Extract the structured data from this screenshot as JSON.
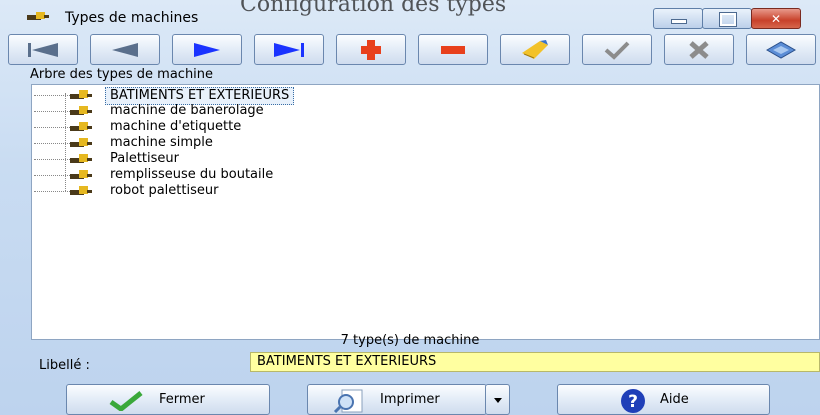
{
  "window": {
    "title": "Types de machines",
    "ghost_title": "Configuration des types"
  },
  "toolbar": {
    "first": "first-record-icon",
    "previous": "previous-record-icon",
    "next": "next-record-icon",
    "last": "last-record-icon",
    "add": "add-icon",
    "delete": "delete-icon",
    "edit": "edit-brush-icon",
    "validate": "check-icon",
    "cancel": "cancel-x-icon",
    "options": "keyboard-icon"
  },
  "tree": {
    "label": "Arbre des types de machine",
    "items": [
      "BATIMENTS ET EXTERIEURS",
      "machine de banerolage",
      "machine d'etiquette",
      "machine simple",
      "Palettiseur",
      "remplisseuse du boutaile",
      "robot palettiseur"
    ],
    "selected_index": 0
  },
  "status": {
    "count_text": "7  type(s) de machine"
  },
  "libelle": {
    "label": "Libellé :",
    "value": "BATIMENTS ET EXTERIEURS"
  },
  "buttons": {
    "close": "Fermer",
    "print": "Imprimer",
    "help": "Aide"
  },
  "colors": {
    "selection_field": "#ffffa0",
    "accent_blue": "#1a33ff",
    "add_red": "#e8401c"
  }
}
